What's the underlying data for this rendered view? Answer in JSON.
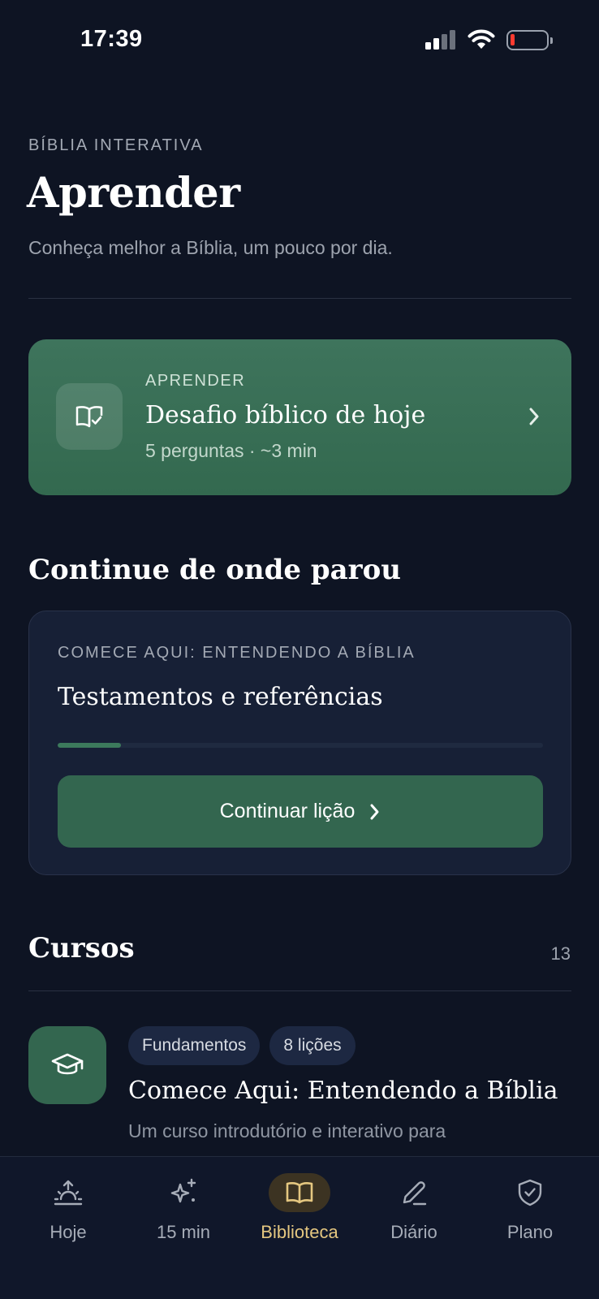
{
  "status_bar": {
    "time": "17:39",
    "battery_level": 0.1,
    "icons": [
      "cellular-signal-icon",
      "wifi-icon",
      "battery-icon"
    ]
  },
  "header": {
    "eyebrow": "BÍBLIA INTERATIVA",
    "title": "Aprender",
    "subtitle": "Conheça melhor a Bíblia, um pouco por dia."
  },
  "daily_challenge": {
    "eyebrow": "APRENDER",
    "title": "Desafio bíblico de hoje",
    "meta": "5 perguntas · ~3 min",
    "icon": "book-check-icon"
  },
  "continue_section": {
    "title": "Continue de onde parou",
    "course_label": "COMECE AQUI: ENTENDENDO A BÍBLIA",
    "lesson_title": "Testamentos e referências",
    "progress": 0.13,
    "button_label": "Continuar lição"
  },
  "courses": {
    "title": "Cursos",
    "count": "13",
    "items": [
      {
        "tags": [
          "Fundamentos",
          "8 lições"
        ],
        "title": "Comece Aqui: Entendendo a Bíblia",
        "description": "Um curso introdutório e interativo para",
        "icon": "graduation-cap-icon"
      }
    ]
  },
  "bottom_nav": {
    "items": [
      {
        "label": "Hoje",
        "icon": "sunrise-icon",
        "active": false
      },
      {
        "label": "15 min",
        "icon": "sparkles-icon",
        "active": false
      },
      {
        "label": "Biblioteca",
        "icon": "open-book-icon",
        "active": true
      },
      {
        "label": "Diário",
        "icon": "pencil-icon",
        "active": false
      },
      {
        "label": "Plano",
        "icon": "shield-check-icon",
        "active": false
      }
    ]
  },
  "colors": {
    "background": "#0e1423",
    "accent_green": "#33664f",
    "active_nav": "#e5c780"
  }
}
